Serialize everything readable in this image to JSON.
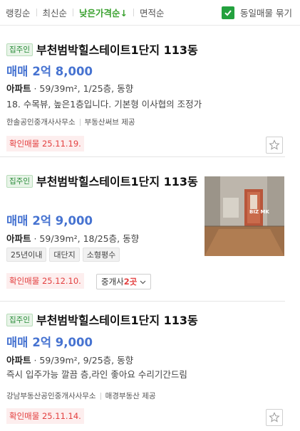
{
  "sort_bar": {
    "items": [
      {
        "label": "랭킹순"
      },
      {
        "label": "최신순"
      },
      {
        "label": "낮은가격순↓"
      },
      {
        "label": "면적순"
      }
    ],
    "dedupe_label": "동일매물 묶기",
    "accent_color": "#3aa12f"
  },
  "listings": [
    {
      "badge": "집주인",
      "title": "부천범박힐스테이트1단지 113동",
      "price_type": "매매",
      "price": "2억 8,000",
      "kind": "아파트",
      "details": " · 59/39m², 1/25층, 동향",
      "description": "18. 수목뷰, 높은1층입니다. 기본형 이사협의 조정가",
      "agent_name": "한솔공인중개사사무소",
      "provider": "부동산써브 제공",
      "confirm": "확인매물 25.11.19."
    },
    {
      "badge": "집주인",
      "title": "부천범박힐스테이트1단지 113동",
      "price_type": "매매",
      "price": "2억 9,000",
      "kind": "아파트",
      "details": " · 59/39m², 18/25층, 동향",
      "tags": [
        "25년이내",
        "대단지",
        "소형평수"
      ],
      "confirm": "확인매물 25.12.10.",
      "agents_prefix": "중개사 ",
      "agents_count": "2곳",
      "photo_watermark": "BIZ MK"
    },
    {
      "badge": "집주인",
      "title": "부천범박힐스테이트1단지 113동",
      "price_type": "매매",
      "price": "2억 9,000",
      "kind": "아파트",
      "details": " · 59/39m², 9/25층, 동향",
      "description": "즉시 입주가능 깔끔 층,라인 좋아요 수리기간드림",
      "agent_name": "강남부동산공인중개사사무소",
      "provider": "매경부동산 제공",
      "confirm": "확인매물 25.11.14."
    }
  ]
}
